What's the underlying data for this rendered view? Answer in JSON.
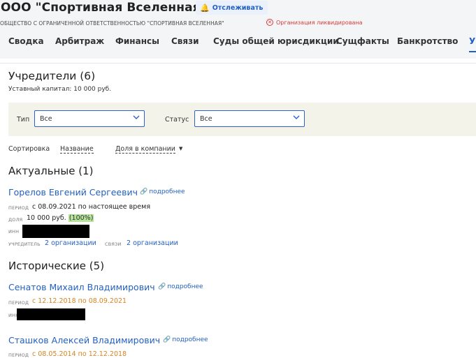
{
  "header": {
    "title": "ООО \"Спортивная Вселенная\"",
    "follow_label": "Отслеживать",
    "full_name": "ОБЩЕСТВО С ОГРАНИЧЕННОЙ ОТВЕТСТВЕННОСТЬЮ \"СПОРТИВНАЯ ВСЕЛЕННАЯ\"",
    "status": "Организация ликвидирована"
  },
  "tabs": [
    {
      "label": "Сводка"
    },
    {
      "label": "Арбитраж"
    },
    {
      "label": "Финансы"
    },
    {
      "label": "Связи"
    },
    {
      "label": "Суды общей юрисдикции"
    },
    {
      "label": "Сущфакты"
    },
    {
      "label": "Банкротство"
    },
    {
      "label": "Уч"
    }
  ],
  "founders": {
    "title": "Учредители (6)",
    "capital": "Уставный капитал: 10 000 руб."
  },
  "filters": {
    "type_label": "Тип",
    "type_value": "Все",
    "status_label": "Статус",
    "status_value": "Все"
  },
  "sort": {
    "label": "Сортировка",
    "by_name": "Название",
    "by_share": "Доля в компании"
  },
  "actual": {
    "title": "Актуальные (1)",
    "person": {
      "name": "Горелов Евгений Сергеевич",
      "more": "подробнее",
      "period_key": "ПЕРИОД",
      "period": "с 08.09.2021 по настоящее время",
      "share_key": "ДОЛЯ",
      "share": "10 000 руб.",
      "share_pct": "(100%)",
      "inn_key": "ИНН",
      "founder_key": "УЧРЕДИТЕЛЬ",
      "founder_link": "2 организации",
      "links_key": "СВЯЗИ",
      "links_link": "2 организации"
    }
  },
  "historical": {
    "title": "Исторические (5)",
    "persons": [
      {
        "name": "Сенатов Михаил Владимирович",
        "more": "подробнее",
        "period_key": "ПЕРИОД",
        "period": "с 12.12.2018 по 08.09.2021",
        "inn_key": "ИНН"
      },
      {
        "name": "Сташков Алексей Владимирович",
        "more": "подробнее",
        "period_key": "ПЕРИОД",
        "period": "с 08.05.2014 по 12.12.2018"
      }
    ]
  },
  "colors": {
    "accent": "#2360c2",
    "danger": "#d93838",
    "historical_period": "#d48422",
    "share_highlight": "#b8e39b"
  }
}
